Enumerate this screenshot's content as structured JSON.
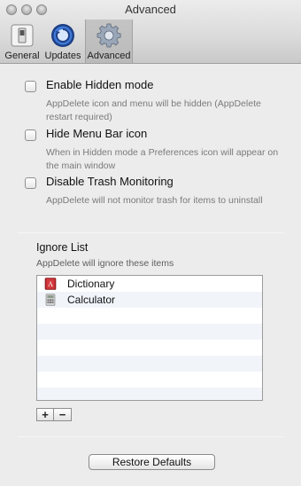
{
  "window": {
    "title": "Advanced"
  },
  "toolbar": {
    "items": [
      {
        "label": "General",
        "icon": "general-switch-icon"
      },
      {
        "label": "Updates",
        "icon": "updates-globe-icon"
      },
      {
        "label": "Advanced",
        "icon": "advanced-gear-icon",
        "selected": true
      }
    ]
  },
  "options": [
    {
      "label": "Enable Hidden mode",
      "checked": false,
      "description": "AppDelete icon and menu will be hidden (AppDelete restart required)"
    },
    {
      "label": "Hide Menu Bar icon",
      "checked": false,
      "description": "When in Hidden mode a Preferences icon will appear on the main window"
    },
    {
      "label": "Disable Trash Monitoring",
      "checked": false,
      "description": "AppDelete will not monitor trash for items to uninstall"
    }
  ],
  "ignore_list": {
    "title": "Ignore List",
    "description": "AppDelete will ignore these items",
    "items": [
      {
        "name": "Dictionary",
        "icon": "dictionary-app-icon"
      },
      {
        "name": "Calculator",
        "icon": "calculator-app-icon"
      }
    ],
    "add_label": "+",
    "remove_label": "−"
  },
  "restore_label": "Restore Defaults"
}
